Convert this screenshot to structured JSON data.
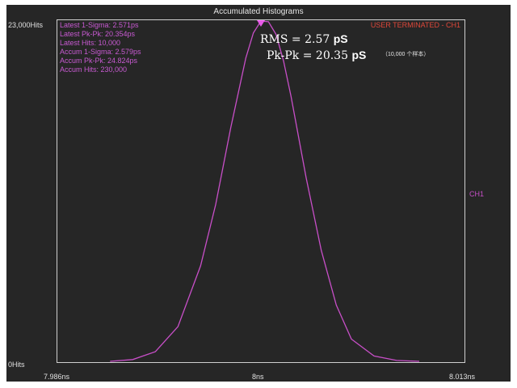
{
  "chart_data": {
    "type": "line",
    "title": "Accumulated Histograms",
    "xlabel": "",
    "ylabel": "",
    "x_ticks": [
      "7.986ns",
      "8ns",
      "8.013ns"
    ],
    "y_ticks": [
      "23,000Hits",
      "0Hits"
    ],
    "xlim": [
      7.986,
      8.013
    ],
    "ylim": [
      0,
      23000
    ],
    "grid": false,
    "series": [
      {
        "name": "CH1",
        "color": "#c84fc8",
        "x": [
          7.9895,
          7.991,
          7.9925,
          7.994,
          7.9955,
          7.9965,
          7.9975,
          7.9985,
          7.999,
          7.9995,
          8.0,
          8.0005,
          8.001,
          8.0015,
          8.0025,
          8.0035,
          8.0045,
          8.0055,
          8.007,
          8.0085,
          8.01
        ],
        "y": [
          0,
          120,
          650,
          2350,
          6450,
          10600,
          15800,
          20500,
          22200,
          23000,
          22950,
          22100,
          20300,
          17900,
          12400,
          7500,
          3800,
          1500,
          360,
          60,
          0
        ]
      }
    ]
  },
  "stats": [
    "Latest 1-Sigma: 2.571ps",
    "Latest Pk-Pk: 20.354ps",
    "Latest Hits: 10,000",
    "Accum 1-Sigma: 2.579ps",
    "Accum Pk-Pk: 24.824ps",
    "Accum Hits: 230,000"
  ],
  "status": "USER TERMINATED - CH1",
  "channel_label": "CH1",
  "marker_color": "#e85ae8",
  "overlay": {
    "rms_prefix": "RMS = 2.57",
    "rms_unit": "pS",
    "pkpk_prefix": "Pk-Pk = 20.35",
    "pkpk_unit": "pS",
    "samples": "（10,000 个样本）"
  }
}
